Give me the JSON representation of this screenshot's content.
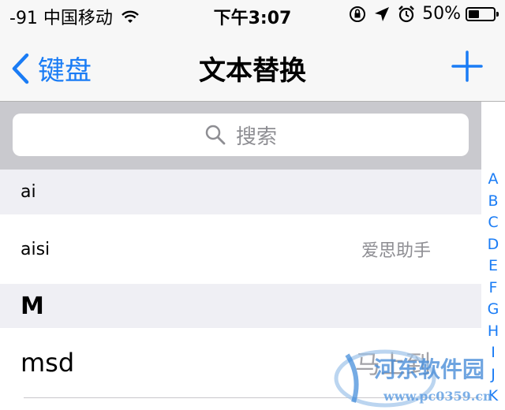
{
  "status_bar": {
    "carrier": "-91 中国移动",
    "time": "下午3:07",
    "battery": "50%",
    "battery_level": 0.5
  },
  "nav": {
    "back_label": "键盘",
    "title": "文本替换",
    "add_icon": "plus-icon"
  },
  "search": {
    "placeholder": "搜索"
  },
  "list": {
    "section_a": "ai",
    "row1": {
      "phrase": "aisi",
      "shortcut": "爱思助手"
    },
    "section_m": "M",
    "row2": {
      "phrase": "msd",
      "shortcut": "马上到"
    }
  },
  "index": [
    "A",
    "B",
    "C",
    "D",
    "E",
    "F",
    "G",
    "H",
    "I",
    "J",
    "K"
  ],
  "watermark": {
    "line1": "河东软件园",
    "line2": "www.pc0359.cn"
  },
  "colors": {
    "accent": "#1a7cf5",
    "secondary": "#8e8e93",
    "section_bg": "#efeff4"
  }
}
